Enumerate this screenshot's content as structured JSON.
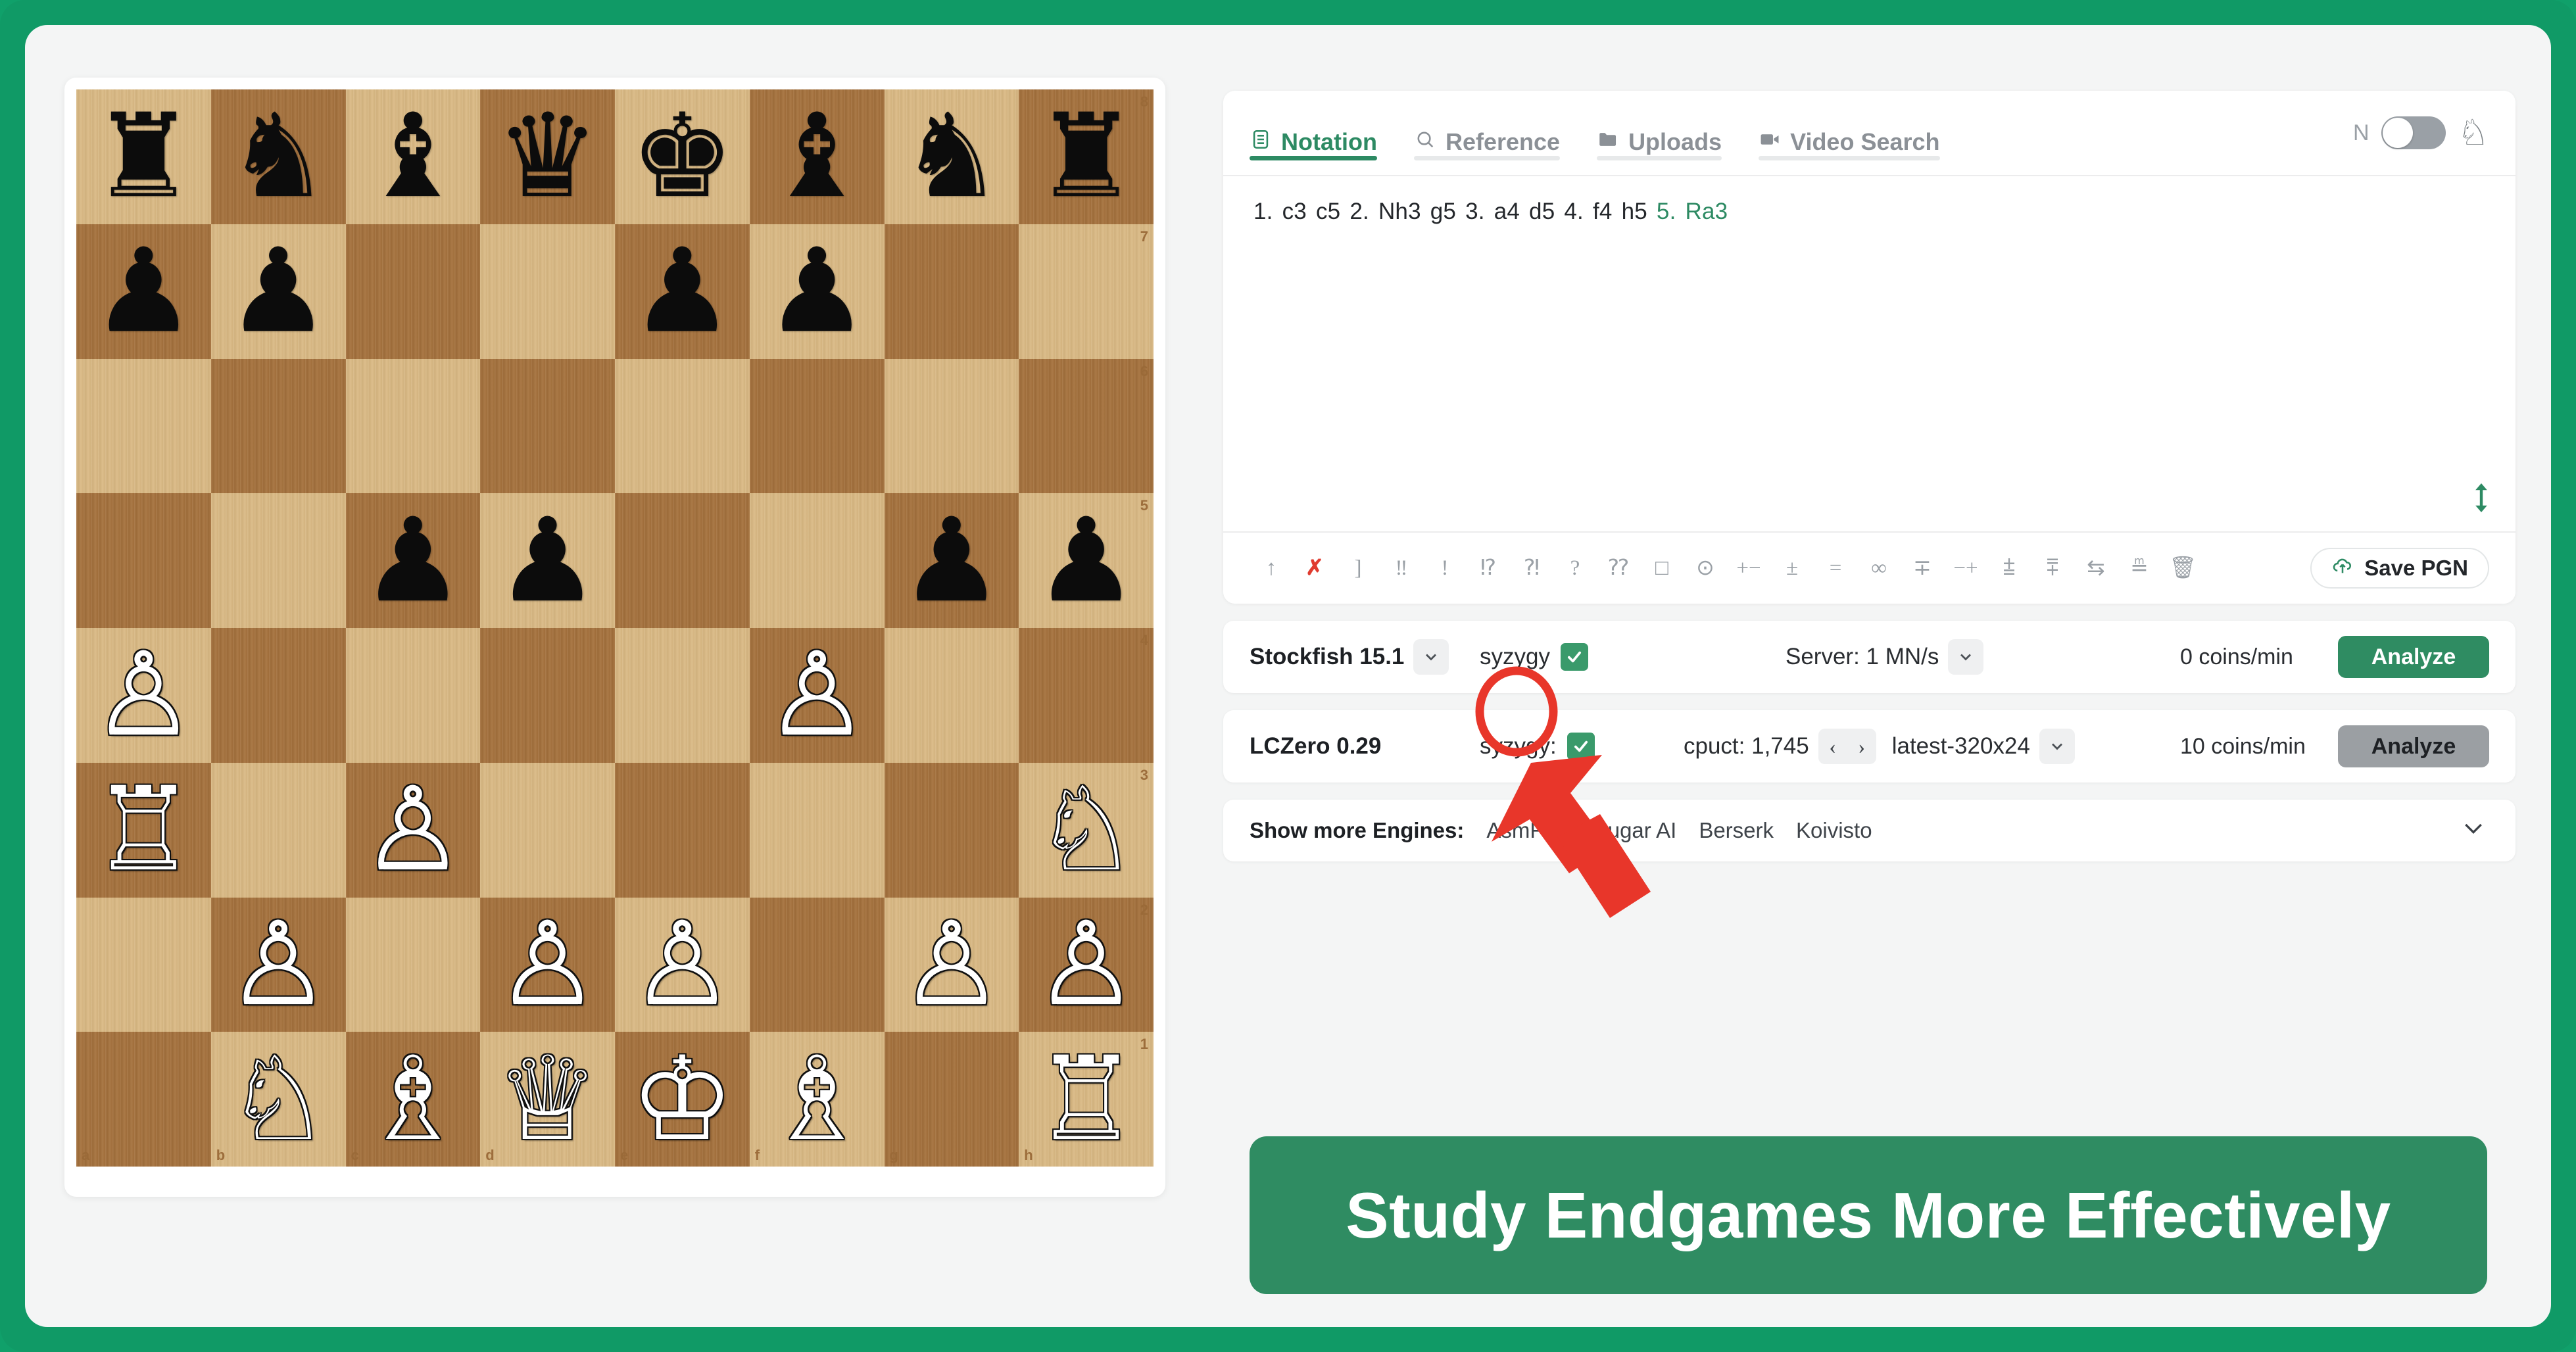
{
  "theme": {
    "frame_green": "#109a66",
    "accent_green": "#2d8a63",
    "banner_green": "#2f8c62",
    "annotation_red": "#e8362a",
    "page_bg": "#f4f5f5"
  },
  "board": {
    "orientation": "white",
    "fen": "rnbqkbnr/pp2pp2/8/2pp2pp/P4P2/R1P4N/1P1PP1PP/1NBQKB1R",
    "rank_labels": [
      "8",
      "7",
      "6",
      "5",
      "4",
      "3",
      "2",
      "1"
    ],
    "file_labels": [
      "a",
      "b",
      "c",
      "d",
      "e",
      "f",
      "g",
      "h"
    ],
    "ranks": [
      [
        "br",
        "bn",
        "bb",
        "bq",
        "bk",
        "bb",
        "bn",
        "br"
      ],
      [
        "bp",
        "bp",
        "",
        "",
        "bp",
        "bp",
        "",
        ""
      ],
      [
        "",
        "",
        "",
        "",
        "",
        "",
        "",
        ""
      ],
      [
        "",
        "",
        "bp",
        "bp",
        "",
        "",
        "bp",
        "bp"
      ],
      [
        "wp",
        "",
        "",
        "",
        "",
        "wp",
        "",
        ""
      ],
      [
        "wr",
        "",
        "wp",
        "",
        "",
        "",
        "",
        "wn"
      ],
      [
        "",
        "wp",
        "",
        "wp",
        "wp",
        "",
        "wp",
        "wp"
      ],
      [
        "",
        "wn",
        "wb",
        "wq",
        "wk",
        "wb",
        "",
        "wr"
      ]
    ]
  },
  "tabs": [
    {
      "label": "Notation",
      "icon": "notation-icon",
      "active": true
    },
    {
      "label": "Reference",
      "icon": "search-icon",
      "active": false
    },
    {
      "label": "Uploads",
      "icon": "folder-icon",
      "active": false
    },
    {
      "label": "Video Search",
      "icon": "video-camera-icon",
      "active": false
    }
  ],
  "header_controls": {
    "toggle_label": "N",
    "toggle_on": false,
    "knight_icon": "knight-piece-icon"
  },
  "notation": {
    "moves": [
      {
        "text": "1.",
        "current": false
      },
      {
        "text": "c3",
        "current": false
      },
      {
        "text": "c5",
        "current": false
      },
      {
        "text": "2.",
        "current": false
      },
      {
        "text": "Nh3",
        "current": false
      },
      {
        "text": "g5",
        "current": false
      },
      {
        "text": "3.",
        "current": false
      },
      {
        "text": "a4",
        "current": false
      },
      {
        "text": "d5",
        "current": false
      },
      {
        "text": "4.",
        "current": false
      },
      {
        "text": "f4",
        "current": false
      },
      {
        "text": "h5",
        "current": false
      },
      {
        "text": "5.",
        "current": true
      },
      {
        "text": "Ra3",
        "current": true
      }
    ],
    "resize_icon": "resize-vertical-icon"
  },
  "annotation_toolbar": {
    "items": [
      {
        "glyph": "↑",
        "name": "initiative-nag",
        "red": false
      },
      {
        "glyph": "✗",
        "name": "clear-nag",
        "red": true
      },
      {
        "glyph": "]",
        "name": "bracket-nag",
        "red": false
      },
      {
        "glyph": "‼",
        "name": "brilliant-nag",
        "red": false
      },
      {
        "glyph": "!",
        "name": "good-move-nag",
        "red": false
      },
      {
        "glyph": "⁉",
        "name": "interesting-nag",
        "red": false
      },
      {
        "glyph": "⁈",
        "name": "dubious-nag",
        "red": false
      },
      {
        "glyph": "?",
        "name": "mistake-nag",
        "red": false
      },
      {
        "glyph": "⁇",
        "name": "blunder-nag",
        "red": false
      },
      {
        "glyph": "□",
        "name": "only-move-nag",
        "red": false
      },
      {
        "glyph": "⊙",
        "name": "zugzwang-nag",
        "red": false
      },
      {
        "glyph": "+−",
        "name": "white-winning-nag",
        "red": false
      },
      {
        "glyph": "±",
        "name": "white-better-nag",
        "red": false
      },
      {
        "glyph": "=",
        "name": "equal-nag",
        "red": false
      },
      {
        "glyph": "∞",
        "name": "unclear-nag",
        "red": false
      },
      {
        "glyph": "∓",
        "name": "black-better-nag",
        "red": false
      },
      {
        "glyph": "−+",
        "name": "black-winning-nag",
        "red": false
      },
      {
        "glyph": "⩲",
        "name": "white-slight-nag",
        "red": false
      },
      {
        "glyph": "⩱",
        "name": "black-slight-nag",
        "red": false
      },
      {
        "glyph": "⇆",
        "name": "counterplay-nag",
        "red": false
      },
      {
        "glyph": "≞",
        "name": "attack-nag",
        "red": false
      },
      {
        "glyph": "🗑",
        "name": "delete-nag",
        "red": false
      }
    ],
    "save_pgn_label": "Save PGN",
    "save_pgn_icon": "cloud-upload-icon"
  },
  "engines": [
    {
      "name": "Stockfish 15.1",
      "has_name_dropdown": true,
      "syzygy_label": "syzygy",
      "syzygy_checked": true,
      "setting_label": "Server: 1 MN/s",
      "setting_type": "dropdown",
      "coins": "0 coins/min",
      "analyze_label": "Analyze",
      "analyze_state": "active"
    },
    {
      "name": "LCZero 0.29",
      "has_name_dropdown": false,
      "syzygy_label": "syzygy:",
      "syzygy_checked": true,
      "setting_label": "cpuct: 1,745",
      "setting_type": "stepper",
      "prev_glyph": "‹",
      "next_glyph": "›",
      "network_label": "latest-320x24",
      "coins": "10 coins/min",
      "analyze_label": "Analyze",
      "analyze_state": "inactive"
    }
  ],
  "more_engines": {
    "label": "Show more Engines:",
    "items": [
      "AsmFish",
      "Sugar AI",
      "Berserk",
      "Koivisto"
    ],
    "expand_icon": "chevron-down-icon"
  },
  "banner": {
    "text": "Study Endgames More Effectively"
  },
  "callout": {
    "type": "red-arrow-and-ellipse",
    "target": "stockfish-syzygy-checkbox"
  }
}
